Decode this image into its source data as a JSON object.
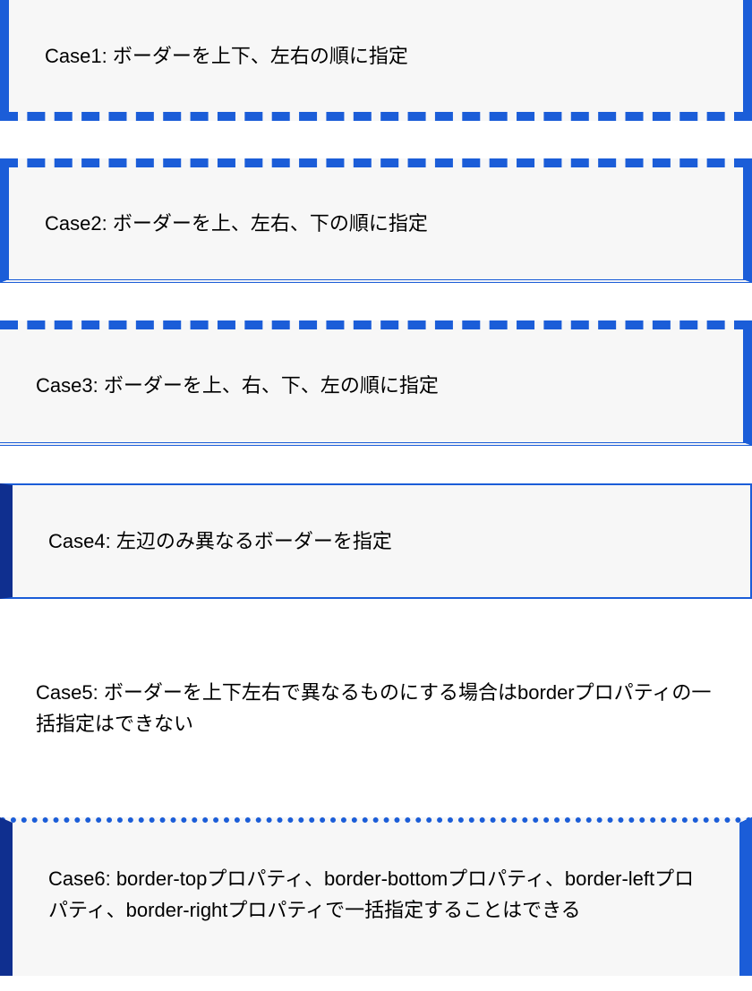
{
  "cases": {
    "case1": "Case1: ボーダーを上下、左右の順に指定",
    "case2": "Case2: ボーダーを上、左右、下の順に指定",
    "case3": "Case3: ボーダーを上、右、下、左の順に指定",
    "case4": "Case4: 左辺のみ異なるボーダーを指定",
    "case5": "Case5: ボーダーを上下左右で異なるものにする場合はborderプロパティの一括指定はできない",
    "case6": "Case6: border-topプロパティ、border-bottomプロパティ、border-leftプロパティ、border-rightプロパティで一括指定することはできる"
  }
}
